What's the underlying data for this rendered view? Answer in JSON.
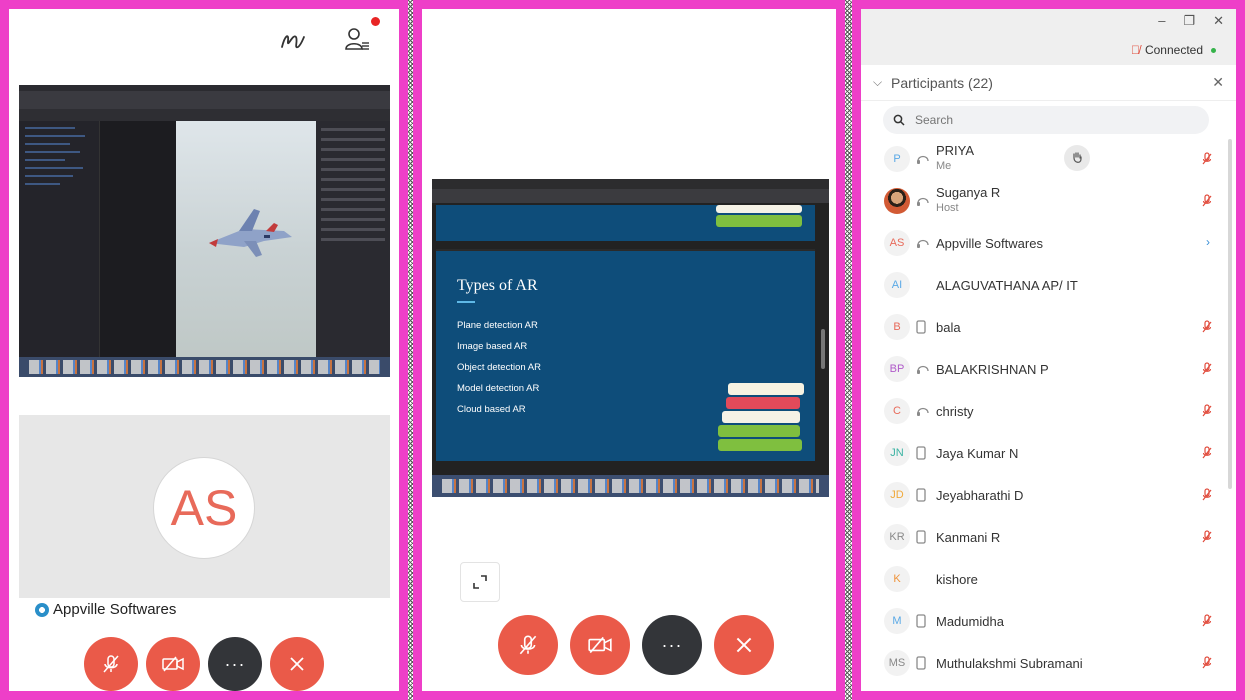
{
  "panel1": {
    "tile_name": "Appville Softwares",
    "avatar_initials": "AS",
    "controls": {
      "mute_icon": "mic-off-icon",
      "video_icon": "video-off-icon",
      "more_label": "···",
      "leave_icon": "close-icon"
    }
  },
  "panel2": {
    "slide": {
      "title": "Types of AR",
      "items": [
        "Plane detection AR",
        "Image based AR",
        "Object detection AR",
        "Model detection AR",
        "Cloud based AR"
      ]
    },
    "controls": {
      "more_label": "···"
    }
  },
  "panel3": {
    "window_controls": [
      "–",
      "❐",
      "✕"
    ],
    "connection_status": "Connected",
    "participants_title": "Participants (22)",
    "search_placeholder": "Search",
    "participants": [
      {
        "initials": "P",
        "name": "PRIYA",
        "sub": "Me",
        "color": "#5aa9e6",
        "status": "headset",
        "mic": true,
        "hand": true
      },
      {
        "initials": "",
        "name": "Suganya R",
        "sub": "Host",
        "color": "#888",
        "status": "headset",
        "mic": true,
        "photo": true
      },
      {
        "initials": "AS",
        "name": "Appville Softwares",
        "sub": "",
        "color": "#e86a5a",
        "status": "headset",
        "more": true
      },
      {
        "initials": "AI",
        "name": "ALAGUVATHANA AP/ IT",
        "sub": "",
        "color": "#5aa9e6",
        "status": ""
      },
      {
        "initials": "B",
        "name": "bala",
        "sub": "",
        "color": "#e86a5a",
        "status": "phone",
        "mic": true
      },
      {
        "initials": "BP",
        "name": "BALAKRISHNAN P",
        "sub": "",
        "color": "#b05ac9",
        "status": "headset",
        "mic": true
      },
      {
        "initials": "C",
        "name": "christy",
        "sub": "",
        "color": "#e86a5a",
        "status": "headset",
        "mic": true
      },
      {
        "initials": "JN",
        "name": "Jaya Kumar N",
        "sub": "",
        "color": "#3bb3a3",
        "status": "phone",
        "mic": true
      },
      {
        "initials": "JD",
        "name": "Jeyabharathi D",
        "sub": "",
        "color": "#f0a93a",
        "status": "phone",
        "mic": true
      },
      {
        "initials": "KR",
        "name": "Kanmani R",
        "sub": "",
        "color": "#888888",
        "status": "phone",
        "mic": true
      },
      {
        "initials": "K",
        "name": "kishore",
        "sub": "",
        "color": "#f0933a",
        "status": ""
      },
      {
        "initials": "M",
        "name": "Madumidha",
        "sub": "",
        "color": "#5aa9e6",
        "status": "phone",
        "mic": true
      },
      {
        "initials": "MS",
        "name": "Muthulakshmi Subramani",
        "sub": "",
        "color": "#888888",
        "status": "phone",
        "mic": true
      }
    ]
  },
  "colors": {
    "frame": "#ee3fc8",
    "control_red": "#ea5a49",
    "control_dark": "#333539",
    "slide_blue": "#0e4d7a"
  }
}
